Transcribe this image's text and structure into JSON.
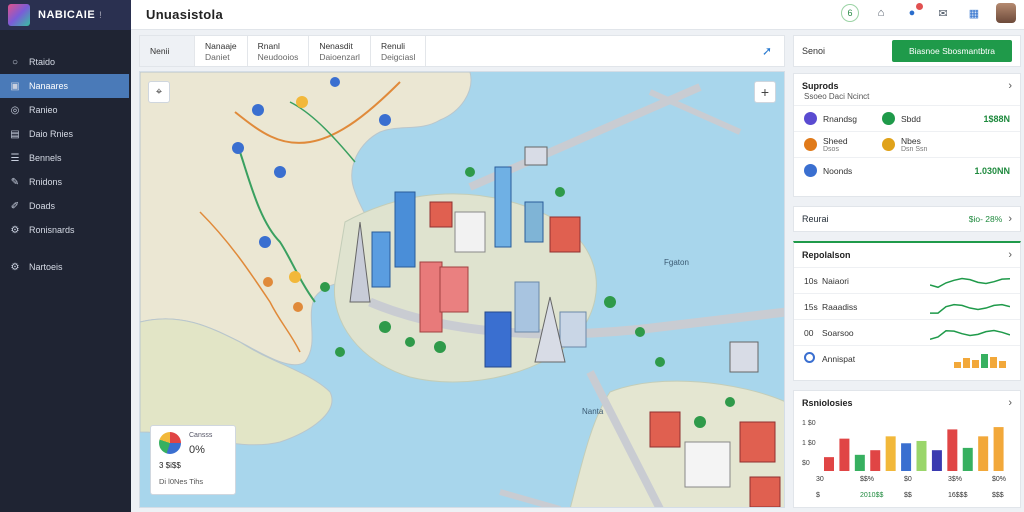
{
  "brand": {
    "name": "NABICAIE",
    "badge": "!"
  },
  "app": {
    "title": "Unuasistola"
  },
  "sidebar": {
    "items": [
      {
        "label": "Rtaido",
        "icon": "circle-icon",
        "glyph": "○",
        "active": false
      },
      {
        "label": "Nanaares",
        "icon": "image-icon",
        "glyph": "▣",
        "active": true
      },
      {
        "label": "Ranieo",
        "icon": "gear-icon",
        "glyph": "◎",
        "active": false
      },
      {
        "label": "Daio Rnies",
        "icon": "document-icon",
        "glyph": "▤",
        "active": false
      },
      {
        "label": "Bennels",
        "icon": "list-icon",
        "glyph": "☰",
        "active": false
      },
      {
        "label": "Rnidons",
        "icon": "pen-icon",
        "glyph": "✎",
        "active": false
      },
      {
        "label": "Doads",
        "icon": "pencil-icon",
        "glyph": "✐",
        "active": false
      },
      {
        "label": "Ronisnards",
        "icon": "settings-icon",
        "glyph": "⚙",
        "active": false
      },
      {
        "label": "Nartoeis",
        "icon": "gear-icon",
        "glyph": "⚙",
        "active": false
      }
    ]
  },
  "tabs": [
    {
      "title": "Nenii",
      "sub": ""
    },
    {
      "title": "Nanaaje",
      "sub": "Daniet"
    },
    {
      "title": "Rnanl",
      "sub": "Neudooios"
    },
    {
      "title": "Nenasdit",
      "sub": "Daioenzarl"
    },
    {
      "title": "Renuli",
      "sub": "Deigciasl"
    }
  ],
  "topbar": {
    "icons": [
      "grid-icon",
      "home-icon",
      "notification-icon",
      "mail-icon",
      "apps-icon"
    ],
    "badge_text": "6"
  },
  "map": {
    "labels": {
      "east": "Fgaton",
      "south": "Nanta"
    },
    "legend": {
      "title": "Cansss",
      "value": "0%",
      "row1": "3 $i$$",
      "row2": "Di l0Nes  Tihs"
    }
  },
  "right": {
    "search_label": "Senoi",
    "search_button": "Biasnoe Sbosmantbtra",
    "stats": {
      "title": "Suprods",
      "subtitle": "Ssoeo Daci Ncinct",
      "rows": [
        {
          "a": "Rnandsg",
          "a_color": "#5a4bd1",
          "b": "Sbdd",
          "b_color": "#1f9a4a",
          "b_sub": "",
          "a_sub": "",
          "value": "1$88N"
        },
        {
          "a": "Sheed",
          "a_color": "#e07a1a",
          "a_sub": "Dsos",
          "b": "Nbes",
          "b_color": "#e0a21a",
          "b_sub": "Dsn Ssn",
          "value": ""
        },
        {
          "a": "Noonds",
          "a_color": "#3a6fd0",
          "a_sub": "",
          "b": "",
          "b_color": "",
          "b_sub": "",
          "value": "1.030NN"
        }
      ]
    },
    "summary": {
      "label": "Reurai",
      "ratio": "$io-  28%"
    },
    "trends": {
      "title": "Repolalson",
      "rows": [
        {
          "k": "10s",
          "label": "Naiaori"
        },
        {
          "k": "15s",
          "label": "Raaadiss"
        },
        {
          "k": "00",
          "label": "Soarsoo"
        },
        {
          "k": "",
          "label": "Annispat"
        }
      ]
    },
    "bars_card": {
      "title": "Rsniolosies",
      "ylabels": [
        "1 $0",
        "1 $0",
        "$0"
      ],
      "xlabels": [
        "30",
        "$$%",
        "$0",
        "3$%",
        "$0%"
      ],
      "xlabels2": [
        "$",
        "2010$$",
        "$$",
        "16$$$",
        "$$$"
      ],
      "values": [
        12,
        28,
        14,
        18,
        30,
        24,
        26,
        18,
        36,
        20,
        30,
        38
      ],
      "colors": [
        "#e04545",
        "#e04545",
        "#37b060",
        "#e04545",
        "#f2b83a",
        "#3a6fd0",
        "#9ad66a",
        "#3a3ab0",
        "#e04545",
        "#37b060",
        "#f2a83a",
        "#f2a83a"
      ],
      "ymax": 45
    }
  },
  "colors": {
    "accent": "#1f9a4a",
    "sidebar": "#1f2433",
    "active": "#4a7ab8",
    "water": "#a8d6ec",
    "land": "#eae6d6"
  }
}
